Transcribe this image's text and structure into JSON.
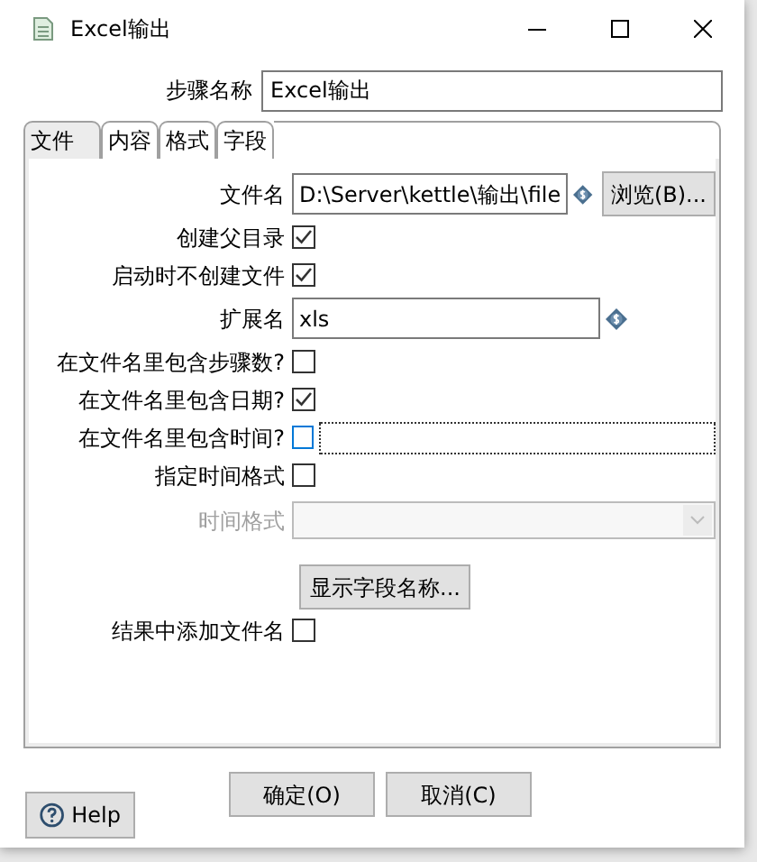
{
  "window": {
    "title": "Excel输出"
  },
  "step_name": {
    "label": "步骤名称",
    "value": "Excel输出"
  },
  "tabs": [
    {
      "label": "文件",
      "selected": true
    },
    {
      "label": "内容",
      "selected": false
    },
    {
      "label": "格式",
      "selected": false
    },
    {
      "label": "字段",
      "selected": false
    }
  ],
  "rows": [
    {
      "kind": "text",
      "label": "文件名",
      "value": "D:\\Server\\kettle\\输出\\file",
      "button": "浏览(B)..."
    },
    {
      "kind": "checkbox",
      "label": "创建父目录",
      "checked": true
    },
    {
      "kind": "checkbox",
      "label": "启动时不创建文件",
      "checked": true
    },
    {
      "kind": "text",
      "label": "扩展名",
      "value": "xls"
    },
    {
      "kind": "checkbox",
      "label": "在文件名里包含步骤数?",
      "checked": false
    },
    {
      "kind": "checkbox",
      "label": "在文件名里包含日期?",
      "checked": true
    },
    {
      "kind": "checkbox_field",
      "label": "在文件名里包含时间?",
      "checked": false,
      "focused": true
    },
    {
      "kind": "checkbox",
      "label": "指定时间格式",
      "checked": false
    },
    {
      "kind": "select",
      "label": "时间格式",
      "disabled": true
    },
    {
      "kind": "button",
      "label": "显示字段名称..."
    },
    {
      "kind": "checkbox",
      "label": "结果中添加文件名",
      "checked": false
    }
  ],
  "buttons": [
    "确定(O)",
    "取消(C)"
  ],
  "help": "Help"
}
